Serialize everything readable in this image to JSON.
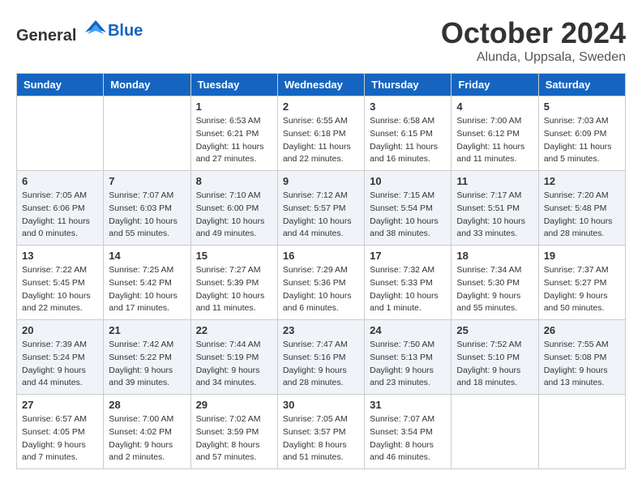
{
  "header": {
    "logo_general": "General",
    "logo_blue": "Blue",
    "month": "October 2024",
    "location": "Alunda, Uppsala, Sweden"
  },
  "weekdays": [
    "Sunday",
    "Monday",
    "Tuesday",
    "Wednesday",
    "Thursday",
    "Friday",
    "Saturday"
  ],
  "weeks": [
    {
      "alt": false,
      "days": [
        {
          "num": "",
          "info": ""
        },
        {
          "num": "",
          "info": ""
        },
        {
          "num": "1",
          "info": "Sunrise: 6:53 AM\nSunset: 6:21 PM\nDaylight: 11 hours and 27 minutes."
        },
        {
          "num": "2",
          "info": "Sunrise: 6:55 AM\nSunset: 6:18 PM\nDaylight: 11 hours and 22 minutes."
        },
        {
          "num": "3",
          "info": "Sunrise: 6:58 AM\nSunset: 6:15 PM\nDaylight: 11 hours and 16 minutes."
        },
        {
          "num": "4",
          "info": "Sunrise: 7:00 AM\nSunset: 6:12 PM\nDaylight: 11 hours and 11 minutes."
        },
        {
          "num": "5",
          "info": "Sunrise: 7:03 AM\nSunset: 6:09 PM\nDaylight: 11 hours and 5 minutes."
        }
      ]
    },
    {
      "alt": true,
      "days": [
        {
          "num": "6",
          "info": "Sunrise: 7:05 AM\nSunset: 6:06 PM\nDaylight: 11 hours and 0 minutes."
        },
        {
          "num": "7",
          "info": "Sunrise: 7:07 AM\nSunset: 6:03 PM\nDaylight: 10 hours and 55 minutes."
        },
        {
          "num": "8",
          "info": "Sunrise: 7:10 AM\nSunset: 6:00 PM\nDaylight: 10 hours and 49 minutes."
        },
        {
          "num": "9",
          "info": "Sunrise: 7:12 AM\nSunset: 5:57 PM\nDaylight: 10 hours and 44 minutes."
        },
        {
          "num": "10",
          "info": "Sunrise: 7:15 AM\nSunset: 5:54 PM\nDaylight: 10 hours and 38 minutes."
        },
        {
          "num": "11",
          "info": "Sunrise: 7:17 AM\nSunset: 5:51 PM\nDaylight: 10 hours and 33 minutes."
        },
        {
          "num": "12",
          "info": "Sunrise: 7:20 AM\nSunset: 5:48 PM\nDaylight: 10 hours and 28 minutes."
        }
      ]
    },
    {
      "alt": false,
      "days": [
        {
          "num": "13",
          "info": "Sunrise: 7:22 AM\nSunset: 5:45 PM\nDaylight: 10 hours and 22 minutes."
        },
        {
          "num": "14",
          "info": "Sunrise: 7:25 AM\nSunset: 5:42 PM\nDaylight: 10 hours and 17 minutes."
        },
        {
          "num": "15",
          "info": "Sunrise: 7:27 AM\nSunset: 5:39 PM\nDaylight: 10 hours and 11 minutes."
        },
        {
          "num": "16",
          "info": "Sunrise: 7:29 AM\nSunset: 5:36 PM\nDaylight: 10 hours and 6 minutes."
        },
        {
          "num": "17",
          "info": "Sunrise: 7:32 AM\nSunset: 5:33 PM\nDaylight: 10 hours and 1 minute."
        },
        {
          "num": "18",
          "info": "Sunrise: 7:34 AM\nSunset: 5:30 PM\nDaylight: 9 hours and 55 minutes."
        },
        {
          "num": "19",
          "info": "Sunrise: 7:37 AM\nSunset: 5:27 PM\nDaylight: 9 hours and 50 minutes."
        }
      ]
    },
    {
      "alt": true,
      "days": [
        {
          "num": "20",
          "info": "Sunrise: 7:39 AM\nSunset: 5:24 PM\nDaylight: 9 hours and 44 minutes."
        },
        {
          "num": "21",
          "info": "Sunrise: 7:42 AM\nSunset: 5:22 PM\nDaylight: 9 hours and 39 minutes."
        },
        {
          "num": "22",
          "info": "Sunrise: 7:44 AM\nSunset: 5:19 PM\nDaylight: 9 hours and 34 minutes."
        },
        {
          "num": "23",
          "info": "Sunrise: 7:47 AM\nSunset: 5:16 PM\nDaylight: 9 hours and 28 minutes."
        },
        {
          "num": "24",
          "info": "Sunrise: 7:50 AM\nSunset: 5:13 PM\nDaylight: 9 hours and 23 minutes."
        },
        {
          "num": "25",
          "info": "Sunrise: 7:52 AM\nSunset: 5:10 PM\nDaylight: 9 hours and 18 minutes."
        },
        {
          "num": "26",
          "info": "Sunrise: 7:55 AM\nSunset: 5:08 PM\nDaylight: 9 hours and 13 minutes."
        }
      ]
    },
    {
      "alt": false,
      "days": [
        {
          "num": "27",
          "info": "Sunrise: 6:57 AM\nSunset: 4:05 PM\nDaylight: 9 hours and 7 minutes."
        },
        {
          "num": "28",
          "info": "Sunrise: 7:00 AM\nSunset: 4:02 PM\nDaylight: 9 hours and 2 minutes."
        },
        {
          "num": "29",
          "info": "Sunrise: 7:02 AM\nSunset: 3:59 PM\nDaylight: 8 hours and 57 minutes."
        },
        {
          "num": "30",
          "info": "Sunrise: 7:05 AM\nSunset: 3:57 PM\nDaylight: 8 hours and 51 minutes."
        },
        {
          "num": "31",
          "info": "Sunrise: 7:07 AM\nSunset: 3:54 PM\nDaylight: 8 hours and 46 minutes."
        },
        {
          "num": "",
          "info": ""
        },
        {
          "num": "",
          "info": ""
        }
      ]
    }
  ]
}
